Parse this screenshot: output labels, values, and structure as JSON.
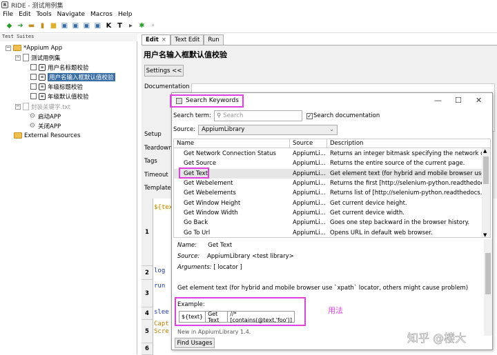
{
  "app": {
    "title": "RIDE - 测试用例集"
  },
  "menu": [
    "File",
    "Edit",
    "Tools",
    "Navigate",
    "Macros",
    "Help"
  ],
  "toolbar_icons": [
    "open-folder-icon",
    "open-icon",
    "save-icon",
    "save-all-icon",
    "new-suite-icon",
    "new-test-icon",
    "new-keyword-icon",
    "keyword-icon",
    "test-icon",
    "run-icon",
    "stop-icon",
    "settings-icon"
  ],
  "left_panel": {
    "header": "Test Suites",
    "tree": [
      {
        "label": "*Appium App",
        "level": 0
      },
      {
        "label": "测试用例集",
        "level": 1
      },
      {
        "label": "用户名标题校验",
        "level": 2
      },
      {
        "label": "用户名输入框默认值校验",
        "level": 2,
        "selected": true
      },
      {
        "label": "年级标题校验",
        "level": 2
      },
      {
        "label": "年级默认值校验",
        "level": 2
      },
      {
        "label": "封装关键字.txt",
        "level": 1,
        "greyed": true
      },
      {
        "label": "启动APP",
        "level": 2
      },
      {
        "label": "关闭APP",
        "level": 2
      },
      {
        "label": "External Resources",
        "level": 0
      }
    ]
  },
  "tabs": [
    "Edit",
    "Text Edit",
    "Run"
  ],
  "editor": {
    "title": "用户名输入框默认值校验",
    "settings_button": "Settings <<",
    "labels": [
      "Documentation",
      "Setup",
      "Teardown",
      "Tags",
      "Timeout",
      "Template"
    ],
    "rows": [
      {
        "num": "1",
        "text": "${tex"
      },
      {
        "num": "2",
        "text": "log"
      },
      {
        "num": "3",
        "text": "run"
      },
      {
        "num": "4",
        "text": "slee"
      },
      {
        "num": "5",
        "text": "Capt",
        "text2": "Scre"
      },
      {
        "num": "6",
        "text": ""
      }
    ]
  },
  "dialog": {
    "title": "Search Keywords",
    "search_label": "Search term:",
    "search_placeholder": "Search",
    "search_doc_label": "Search documentation",
    "search_doc_checked": true,
    "source_label": "Source:",
    "source_value": "AppiumLibrary",
    "columns": [
      "Name",
      "Source",
      "Description"
    ],
    "keywords": [
      {
        "name": "Get Network Connection Status",
        "source": "AppiumLi...",
        "desc": "Returns an integer bitmask specifying the network co..."
      },
      {
        "name": "Get Source",
        "source": "AppiumLi...",
        "desc": "Returns the entire source of the current page."
      },
      {
        "name": "Get Text",
        "source": "AppiumLi...",
        "desc": "Get element text (for hybrid and mobile browser use...",
        "highlight": true
      },
      {
        "name": "Get Webelement",
        "source": "AppiumLi...",
        "desc": "Returns the first [http://selenium-python.readthedocs..."
      },
      {
        "name": "Get Webelements",
        "source": "AppiumLi...",
        "desc": "Returns list of [http://selenium-python.readthedocs.io..."
      },
      {
        "name": "Get Window Height",
        "source": "AppiumLi...",
        "desc": "Get current device height."
      },
      {
        "name": "Get Window Width",
        "source": "AppiumLi...",
        "desc": "Get current device width."
      },
      {
        "name": "Go Back",
        "source": "AppiumLi...",
        "desc": "Goes one step backward in the browser history."
      },
      {
        "name": "Go To Url",
        "source": "AppiumLi...",
        "desc": "Opens URL in default web browser."
      }
    ],
    "detail": {
      "name_label": "Name:",
      "name_value": "Get Text",
      "source_label": "Source:",
      "source_value": "AppiumLibrary <test library>",
      "arguments_label": "Arguments:",
      "arguments_value": "[ locator ]",
      "description": "Get element text (for hybrid and mobile browser use `xpath` locator, others might cause problem)",
      "example_label": "Example:",
      "example_cells": [
        "${text}",
        "Get Text",
        "//*[contains(@text,'foo')]"
      ],
      "footer": "New in AppiumLibrary 1.4."
    },
    "find_usages": "Find Usages"
  },
  "annotation": "用法",
  "watermark": "知乎 @楼大"
}
